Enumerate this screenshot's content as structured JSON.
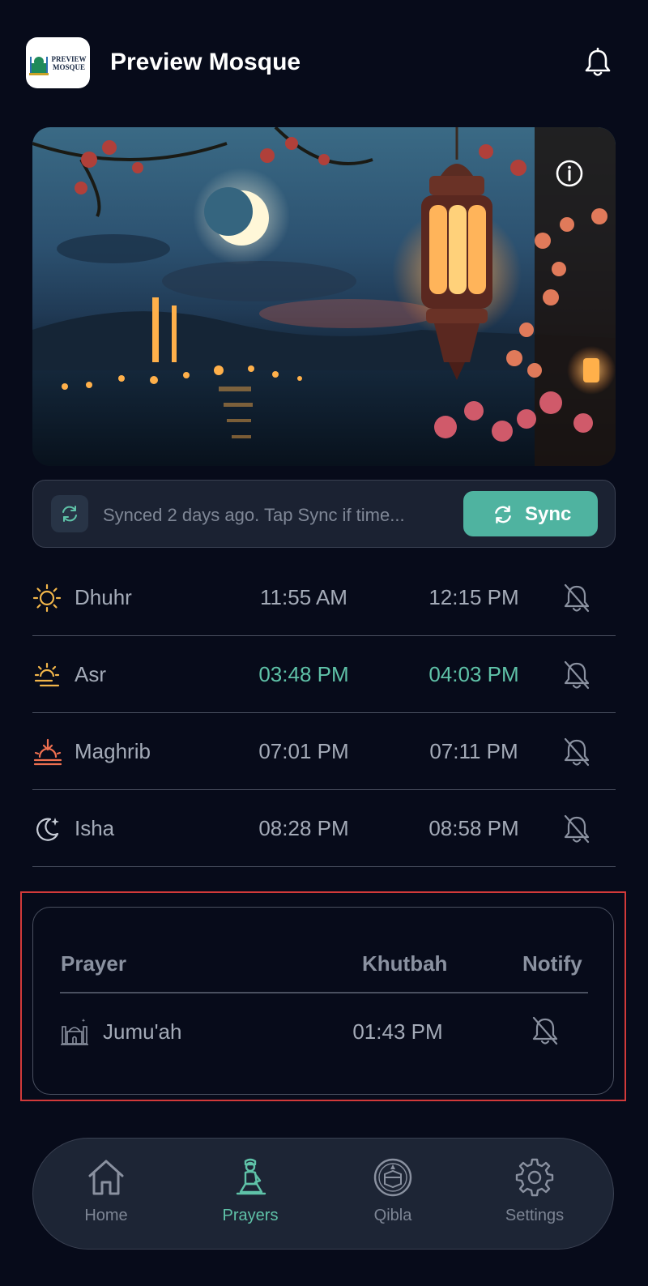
{
  "header": {
    "title": "Preview Mosque",
    "logo_text": "PREVIEW MOSQUE"
  },
  "sync": {
    "status": "Synced 2 days ago. Tap Sync if time...",
    "button_label": "Sync"
  },
  "prayers": [
    {
      "name": "Dhuhr",
      "adhan": "11:55 AM",
      "iqamah": "12:15 PM",
      "icon": "sun-icon",
      "active": false
    },
    {
      "name": "Asr",
      "adhan": "03:48 PM",
      "iqamah": "04:03 PM",
      "icon": "sun-cloud-icon",
      "active": true
    },
    {
      "name": "Maghrib",
      "adhan": "07:01 PM",
      "iqamah": "07:11 PM",
      "icon": "sunset-icon",
      "active": false
    },
    {
      "name": "Isha",
      "adhan": "08:28 PM",
      "iqamah": "08:58 PM",
      "icon": "moon-star-icon",
      "active": false
    }
  ],
  "jumuah": {
    "headers": {
      "prayer": "Prayer",
      "khutbah": "Khutbah",
      "notify": "Notify"
    },
    "rows": [
      {
        "name": "Jumu'ah",
        "khutbah": "01:43 PM"
      }
    ]
  },
  "tabs": [
    {
      "label": "Home",
      "icon": "home-icon",
      "active": false
    },
    {
      "label": "Prayers",
      "icon": "praying-person-icon",
      "active": true
    },
    {
      "label": "Qibla",
      "icon": "kaaba-compass-icon",
      "active": false
    },
    {
      "label": "Settings",
      "icon": "gear-icon",
      "active": false
    }
  ],
  "colors": {
    "accent": "#5fc2a8",
    "sync_button": "#4fb3a0",
    "background": "#070b1a",
    "highlight": "#d23a3a"
  }
}
